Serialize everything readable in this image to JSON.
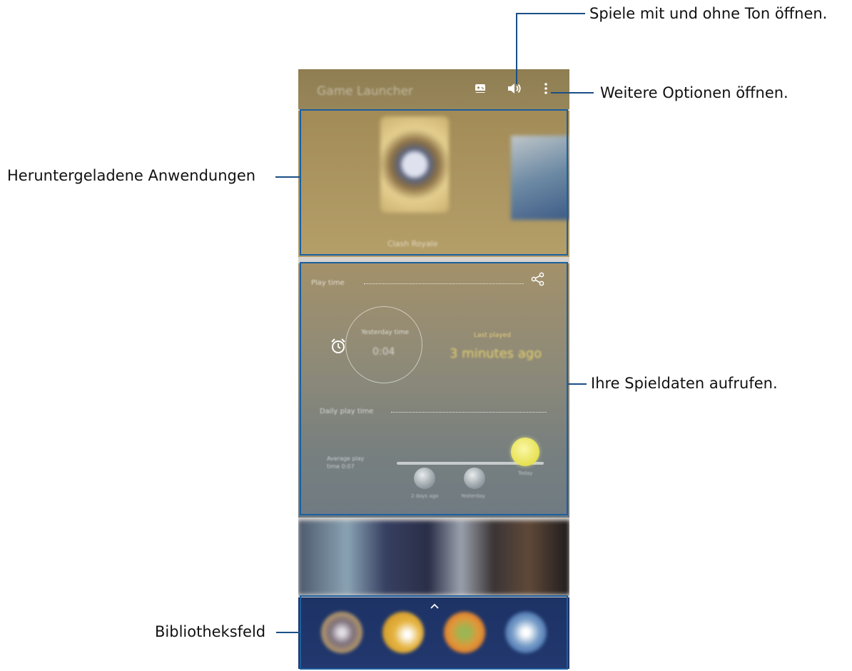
{
  "callouts": {
    "sound": "Spiele mit und ohne Ton öffnen.",
    "more_options": "Weitere Optionen öffnen.",
    "downloaded_apps": "Heruntergeladene Anwendungen",
    "play_data": "Ihre Spieldaten aufrufen.",
    "library": "Bibliotheksfeld"
  },
  "screen": {
    "app_title": "Game Launcher",
    "icons": [
      "game-tools-icon",
      "volume-icon",
      "more-options-icon"
    ],
    "downloaded_game_name": "Clash Royale",
    "play_time": {
      "header": "Play time",
      "ring_label": "Yesterday time",
      "ring_value": "0:04",
      "last_played_label": "Last played",
      "last_played_value": "3 minutes ago",
      "daily_label": "Daily play time",
      "average_label": "Average play time",
      "average_value": "0:07",
      "day_labels": [
        "2 days ago",
        "Yesterday",
        "Today"
      ]
    }
  },
  "colors": {
    "callout_line": "#1a4f86",
    "frame": "#1b5fa0",
    "topbar": "#8f7e52",
    "library_bg": "#1d3366"
  }
}
